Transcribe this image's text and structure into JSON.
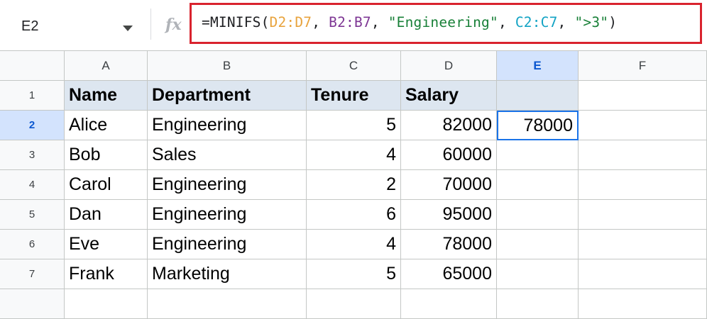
{
  "formula_bar": {
    "name_box": "E2",
    "fx_label": "fx",
    "formula_tokens": [
      {
        "text": "=MINIFS(",
        "color": "#202124"
      },
      {
        "text": "D2:D7",
        "color": "#e8a33d"
      },
      {
        "text": ", ",
        "color": "#202124"
      },
      {
        "text": "B2:B7",
        "color": "#7e3794"
      },
      {
        "text": ", ",
        "color": "#202124"
      },
      {
        "text": "\"Engineering\"",
        "color": "#188038"
      },
      {
        "text": ", ",
        "color": "#202124"
      },
      {
        "text": "C2:C7",
        "color": "#12a3c4"
      },
      {
        "text": ", ",
        "color": "#202124"
      },
      {
        "text": "\">3\"",
        "color": "#188038"
      },
      {
        "text": ")",
        "color": "#202124"
      }
    ]
  },
  "columns": [
    "A",
    "B",
    "C",
    "D",
    "E",
    "F"
  ],
  "active_column": "E",
  "rows": [
    "1",
    "2",
    "3",
    "4",
    "5",
    "6",
    "7"
  ],
  "active_row": "2",
  "cells": {
    "header": [
      "Name",
      "Department",
      "Tenure",
      "Salary",
      ""
    ],
    "data": [
      [
        "Alice",
        "Engineering",
        "5",
        "82000",
        "78000"
      ],
      [
        "Bob",
        "Sales",
        "4",
        "60000",
        ""
      ],
      [
        "Carol",
        "Engineering",
        "2",
        "70000",
        ""
      ],
      [
        "Dan",
        "Engineering",
        "6",
        "95000",
        ""
      ],
      [
        "Eve",
        "Engineering",
        "4",
        "78000",
        ""
      ],
      [
        "Frank",
        "Marketing",
        "5",
        "65000",
        ""
      ]
    ]
  },
  "colors": {
    "selection": "#1a73e8",
    "header_fill": "#dde6f0",
    "formula_highlight_border": "#d9232e"
  }
}
